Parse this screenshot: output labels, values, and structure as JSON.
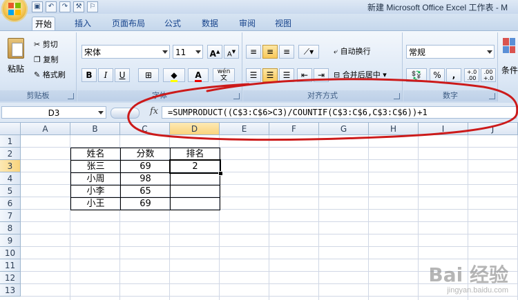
{
  "window": {
    "title": "新建 Microsoft Office Excel 工作表 - M"
  },
  "tabs": [
    "开始",
    "插入",
    "页面布局",
    "公式",
    "数据",
    "审阅",
    "视图"
  ],
  "ribbon": {
    "clipboard": {
      "paste": "粘贴",
      "cut": "剪切",
      "copy": "复制",
      "format_painter": "格式刷",
      "label": "剪贴板"
    },
    "font": {
      "name": "宋体",
      "size": "11",
      "bold": "B",
      "italic": "I",
      "underline": "U",
      "label": "字体",
      "grow": "A",
      "shrink": "A",
      "font_color": "A",
      "wen": "wén",
      "wen_char": "文"
    },
    "alignment": {
      "wrap": "自动换行",
      "merge": "合并后居中",
      "label": "对齐方式"
    },
    "number": {
      "format": "常规",
      "percent": "%",
      "comma": ",",
      "label": "数字",
      "inc_decimal": "+.0\n.00",
      "dec_decimal": ".00\n+.0"
    },
    "styles": {
      "label": "条件"
    }
  },
  "formula_bar": {
    "cell_ref": "D3",
    "fx": "fx",
    "formula": "=SUMPRODUCT((C$3:C$6>C3)/COUNTIF(C$3:C$6,C$3:C$6))+1"
  },
  "columns": [
    "A",
    "B",
    "C",
    "D",
    "E",
    "F",
    "G",
    "H",
    "I",
    "J"
  ],
  "rows": [
    "1",
    "2",
    "3",
    "4",
    "5",
    "6",
    "7",
    "8",
    "9",
    "10",
    "11",
    "12",
    "13"
  ],
  "table": {
    "headers": [
      "姓名",
      "分数",
      "排名"
    ],
    "rows": [
      {
        "name": "张三",
        "score": "69",
        "rank": "2"
      },
      {
        "name": "小周",
        "score": "98",
        "rank": ""
      },
      {
        "name": "小李",
        "score": "65",
        "rank": ""
      },
      {
        "name": "小王",
        "score": "69",
        "rank": ""
      }
    ]
  },
  "watermark": {
    "brand": "Bai 经验",
    "url": "jingyan.baidu.com"
  },
  "colors": {
    "annotation": "#cc1a1a",
    "selection": "#f9d37c",
    "ribbon": "#dbe7f5"
  }
}
